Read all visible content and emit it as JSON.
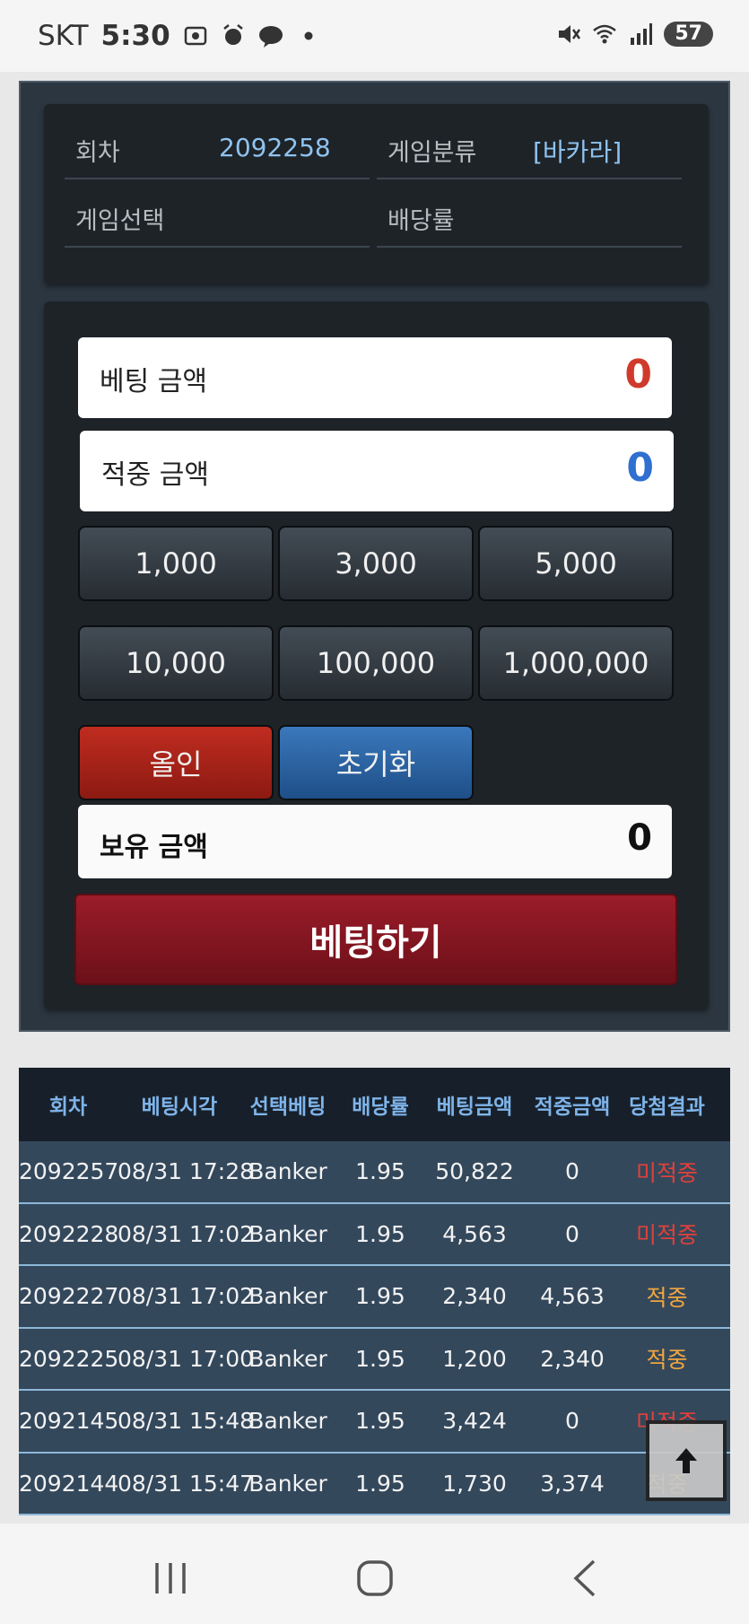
{
  "status_bar": {
    "carrier": "SKT",
    "time": "5:30",
    "battery": "57"
  },
  "info": {
    "round_label": "회차",
    "round_value": "2092258",
    "category_label": "게임분류",
    "category_value": "[바카라]",
    "game_select_label": "게임선택",
    "game_select_value": "",
    "odds_label": "배당률",
    "odds_value": ""
  },
  "bet_form": {
    "bet_amount_label": "베팅 금액",
    "bet_amount_value": "0",
    "win_amount_label": "적중 금액",
    "win_amount_value": "0",
    "chips": [
      "1,000",
      "3,000",
      "5,000",
      "10,000",
      "100,000",
      "1,000,000"
    ],
    "all_in_label": "올인",
    "reset_label": "초기화",
    "holding_label": "보유 금액",
    "holding_value": "0",
    "submit_label": "베팅하기"
  },
  "history": {
    "headers": [
      "회차",
      "베팅시각",
      "선택베팅",
      "배당률",
      "베팅금액",
      "적중금액",
      "당첨결과"
    ],
    "rows": [
      [
        "2092257",
        "08/31 17:28",
        "Banker",
        "1.95",
        "50,822",
        "0",
        "미적중"
      ],
      [
        "2092228",
        "08/31 17:02",
        "Banker",
        "1.95",
        "4,563",
        "0",
        "미적중"
      ],
      [
        "2092227",
        "08/31 17:02",
        "Banker",
        "1.95",
        "2,340",
        "4,563",
        "적중"
      ],
      [
        "2092225",
        "08/31 17:00",
        "Banker",
        "1.95",
        "1,200",
        "2,340",
        "적중"
      ],
      [
        "2092145",
        "08/31 15:48",
        "Banker",
        "1.95",
        "3,424",
        "0",
        "미적중"
      ],
      [
        "2092144",
        "08/31 15:47",
        "Banker",
        "1.95",
        "1,730",
        "3,374",
        "적중"
      ]
    ]
  },
  "colors": {
    "bet_amount": "#d03a2c",
    "win_amount": "#2f6fd0",
    "miss": "#e0413a",
    "hit": "#f0a640"
  }
}
